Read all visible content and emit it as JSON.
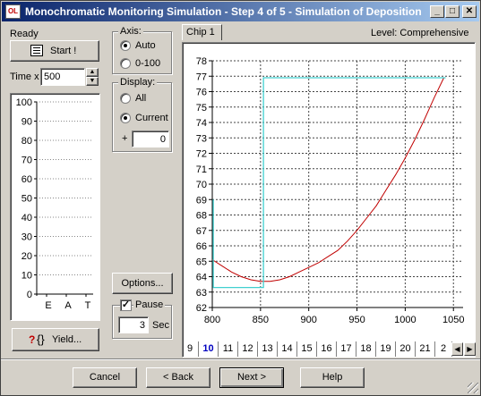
{
  "window": {
    "title": "Monochromatic Monitoring Simulation - Step 4 of 5 - Simulation of Deposition",
    "app_icon_text": "OL",
    "minimize_label": "_",
    "maximize_label": "□",
    "close_label": "✕"
  },
  "left": {
    "status": "Ready",
    "start_label": "Start !",
    "time_label": "Time x",
    "time_value": "500",
    "gauge_ticks": [
      "100",
      "90",
      "80",
      "70",
      "60",
      "50",
      "40",
      "30",
      "20",
      "10",
      "0"
    ],
    "gauge_cols": [
      "E",
      "A",
      "T"
    ],
    "yield_label": "Yield..."
  },
  "middle": {
    "axis_legend": "Axis:",
    "axis_options": [
      "Auto",
      "0-100"
    ],
    "axis_selected": "Auto",
    "display_legend": "Display:",
    "display_options": [
      "All",
      "Current"
    ],
    "display_selected": "Current",
    "plus_label": "+",
    "plus_value": "0",
    "options_label": "Options...",
    "pause_label": "Pause",
    "pause_checked": true,
    "sec_value": "3",
    "sec_label": "Sec"
  },
  "chart_panel": {
    "tab_label": "Chip 1",
    "level_text": "Level: Comprehensive",
    "page_tabs": [
      "9",
      "10",
      "11",
      "12",
      "13",
      "14",
      "15",
      "16",
      "17",
      "18",
      "19",
      "20",
      "21",
      "2"
    ],
    "active_page_tab": "10"
  },
  "buttons": {
    "cancel": "Cancel",
    "back": "< Back",
    "next": "Next >",
    "help": "Help"
  },
  "chart_data": {
    "type": "line",
    "xlabel": "",
    "ylabel": "",
    "xlim": [
      800,
      1060
    ],
    "ylim": [
      62,
      78
    ],
    "xticks": [
      800,
      850,
      900,
      950,
      1000,
      1050
    ],
    "yticks": [
      62,
      63,
      64,
      65,
      66,
      67,
      68,
      69,
      70,
      71,
      72,
      73,
      74,
      75,
      76,
      77,
      78
    ],
    "grid": true,
    "series": [
      {
        "color": "#c00000",
        "x": [
          800,
          810,
          820,
          830,
          840,
          850,
          860,
          870,
          880,
          890,
          900,
          910,
          920,
          930,
          940,
          950,
          960,
          970,
          980,
          990,
          1000,
          1010,
          1020,
          1030,
          1040
        ],
        "y": [
          65.1,
          64.7,
          64.3,
          64.0,
          63.8,
          63.7,
          63.7,
          63.8,
          64.0,
          64.3,
          64.6,
          64.9,
          65.3,
          65.7,
          66.3,
          67.0,
          67.8,
          68.6,
          69.6,
          70.6,
          71.7,
          72.9,
          74.2,
          75.6,
          76.9
        ]
      },
      {
        "color": "#40d0d0",
        "x": [
          801,
          801,
          801,
          853,
          853,
          1042
        ],
        "y": [
          69.0,
          63.3,
          63.3,
          63.3,
          76.9,
          76.9
        ]
      }
    ]
  }
}
